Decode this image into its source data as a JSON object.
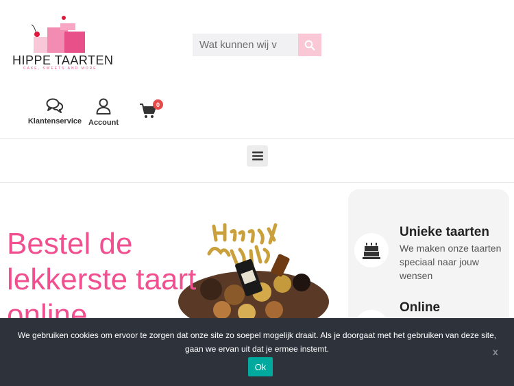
{
  "header": {
    "logo": {
      "name": "HIPPE TAARTEN",
      "tagline": "CAKE, SWEETS AND MORE"
    },
    "search": {
      "placeholder": "Wat kunnen wij v"
    },
    "icons": {
      "service_label": "Klantenservice",
      "account_label": "Account",
      "cart_count": "0"
    }
  },
  "hero": {
    "title": "Bestel de lekkerste taart online"
  },
  "features": [
    {
      "title": "Unieke taarten",
      "text": "We maken onze taarten speciaal naar jouw wensen",
      "icon": "birthday-cake-icon"
    },
    {
      "title": "Online",
      "text": "",
      "icon": "online-icon"
    }
  ],
  "cookie": {
    "text": "We gebruiken cookies om ervoor te zorgen dat onze site zo soepel mogelijk draait. Als je doorgaat met het gebruiken van deze site, gaan we ervan uit dat je ermee instemt.",
    "ok_label": "Ok",
    "close_label": "x"
  },
  "colors": {
    "accent": "#f0508f",
    "search_button": "#f9c7d6",
    "cookie_bg": "#2d323b",
    "ok_button": "#00a99d"
  }
}
